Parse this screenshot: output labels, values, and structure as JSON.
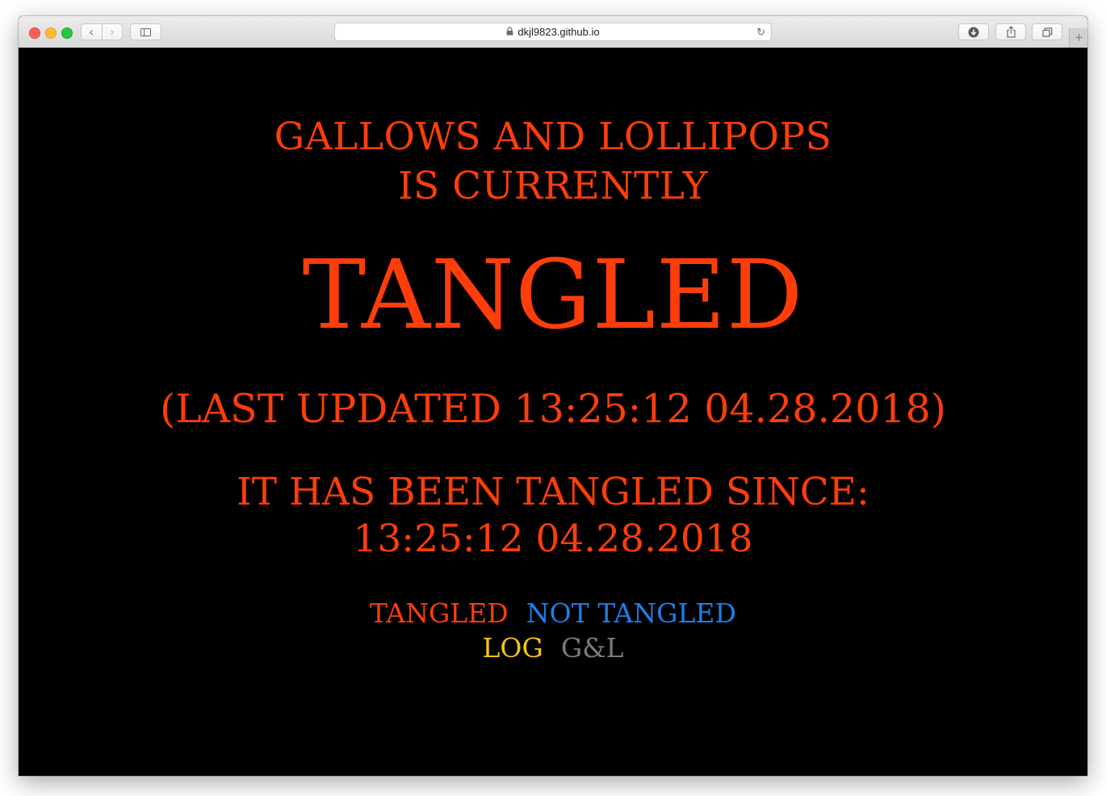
{
  "browser": {
    "url": "dkjl9823.github.io",
    "back_glyph": "‹",
    "forward_glyph": "›",
    "reload_glyph": "↻",
    "new_tab_glyph": "+"
  },
  "colors": {
    "primary": "#ff3d0a",
    "not_tangled": "#1e7fe8",
    "log": "#f5c518",
    "gl": "#7a7a7a",
    "background": "#000000"
  },
  "status": {
    "line1": "GALLOWS AND LOLLIPOPS",
    "line2": "IS CURRENTLY",
    "state": "TANGLED",
    "last_updated": "(LAST UPDATED 13:25:12 04.28.2018)",
    "since_label": "IT HAS BEEN TANGLED SINCE:",
    "since_time": "13:25:12 04.28.2018"
  },
  "links": {
    "tangled": "TANGLED",
    "not_tangled": "NOT TANGLED",
    "log": "LOG",
    "gl": "G&L"
  },
  "icons": {
    "lock": "lock-icon",
    "reload": "reload-icon",
    "download": "download-icon",
    "share": "share-icon",
    "tabs": "tabs-overview-icon",
    "sidebar": "sidebar-icon"
  }
}
